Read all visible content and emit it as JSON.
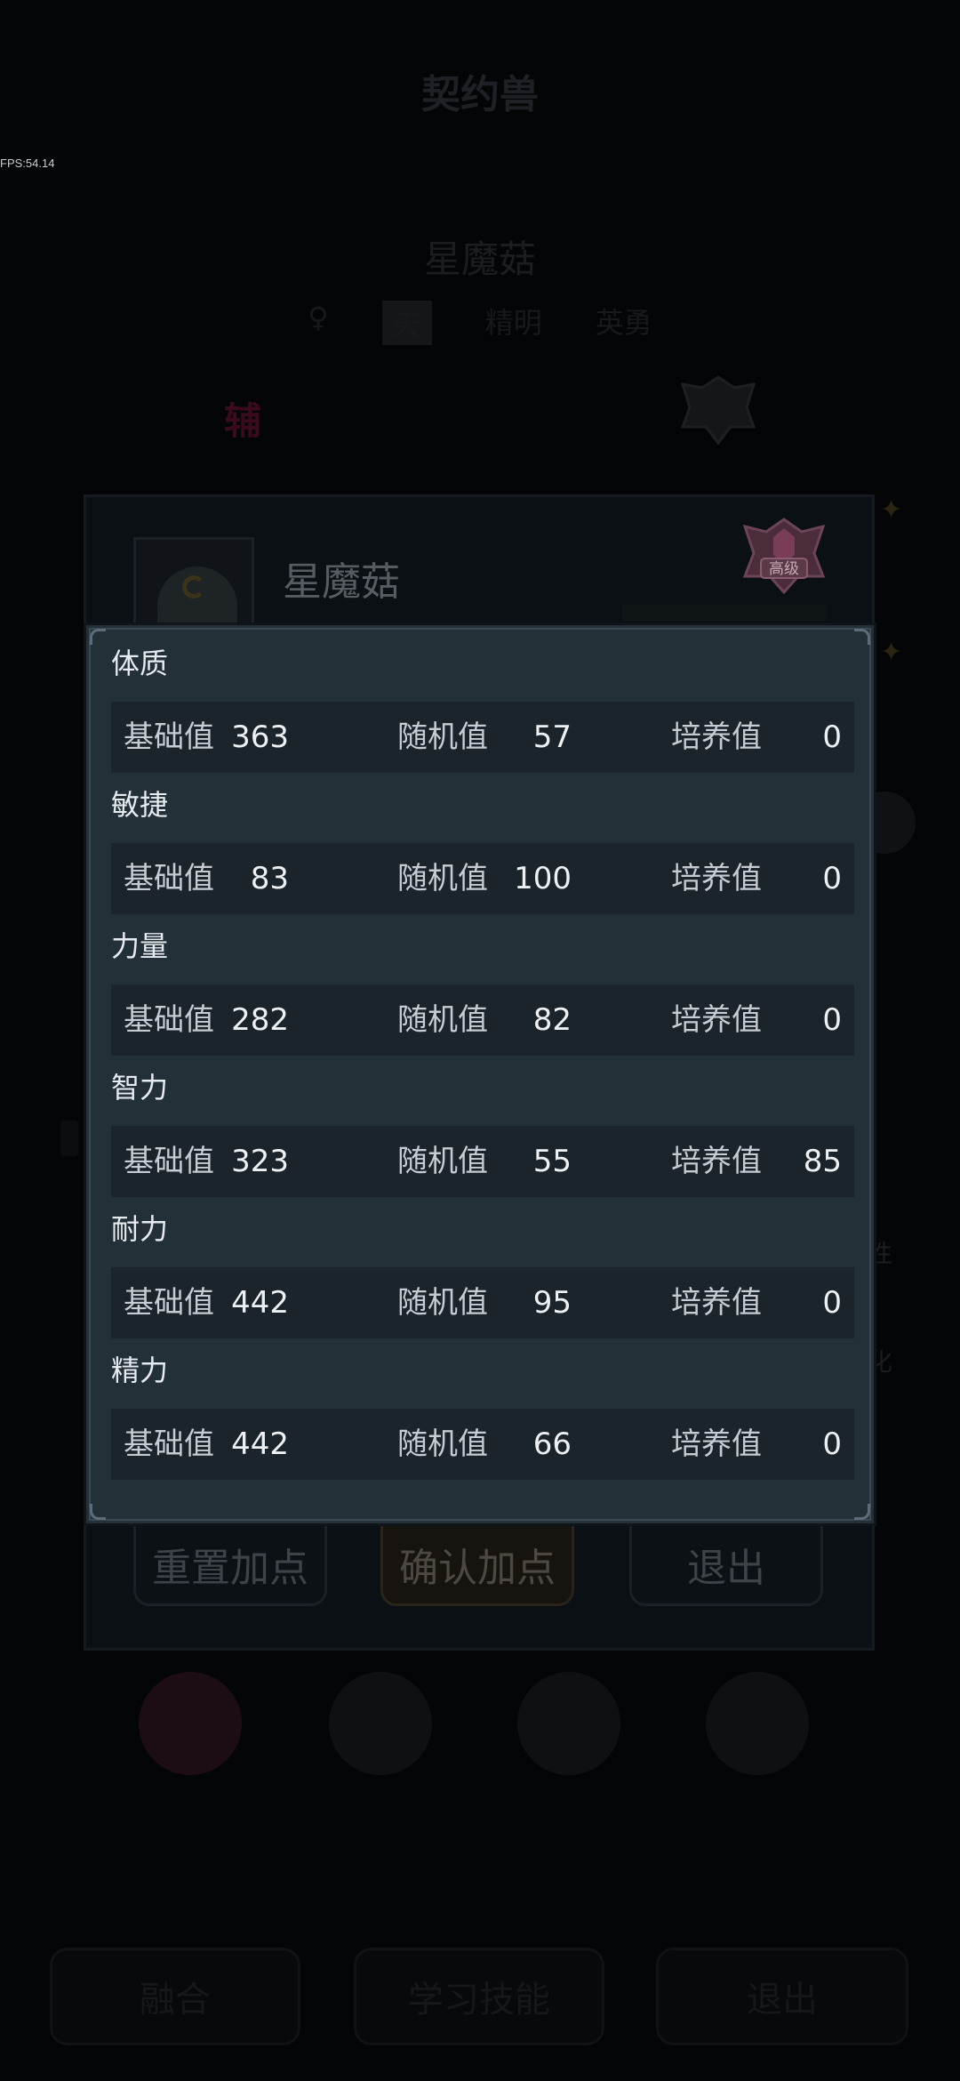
{
  "background": {
    "title": "契约兽",
    "fps": "FPS:54.14",
    "pet_name": "星魔菇",
    "tags": [
      "天",
      "精明",
      "英勇"
    ],
    "vertical_text": "辅",
    "panel_name": "星魔菇",
    "rank_badge": "高级",
    "buttons": {
      "reset": "重置加点",
      "confirm": "确认加点",
      "exit": "退出"
    },
    "bottom_buttons": {
      "fuse": "融合",
      "learn_skill": "学习技能",
      "exit": "退出"
    },
    "side_labels": [
      "性",
      "化"
    ]
  },
  "modal": {
    "label_base": "基础值",
    "label_random": "随机值",
    "label_train": "培养值",
    "stats": [
      {
        "name": "体质",
        "base": "363",
        "random": "57",
        "train": "0"
      },
      {
        "name": "敏捷",
        "base": "83",
        "random": "100",
        "train": "0"
      },
      {
        "name": "力量",
        "base": "282",
        "random": "82",
        "train": "0"
      },
      {
        "name": "智力",
        "base": "323",
        "random": "55",
        "train": "85"
      },
      {
        "name": "耐力",
        "base": "442",
        "random": "95",
        "train": "0"
      },
      {
        "name": "精力",
        "base": "442",
        "random": "66",
        "train": "0"
      }
    ]
  },
  "colors": {
    "modal_bg": "#233038",
    "row_bg": "#1a242a",
    "rank_badge": "#8a4a68"
  }
}
